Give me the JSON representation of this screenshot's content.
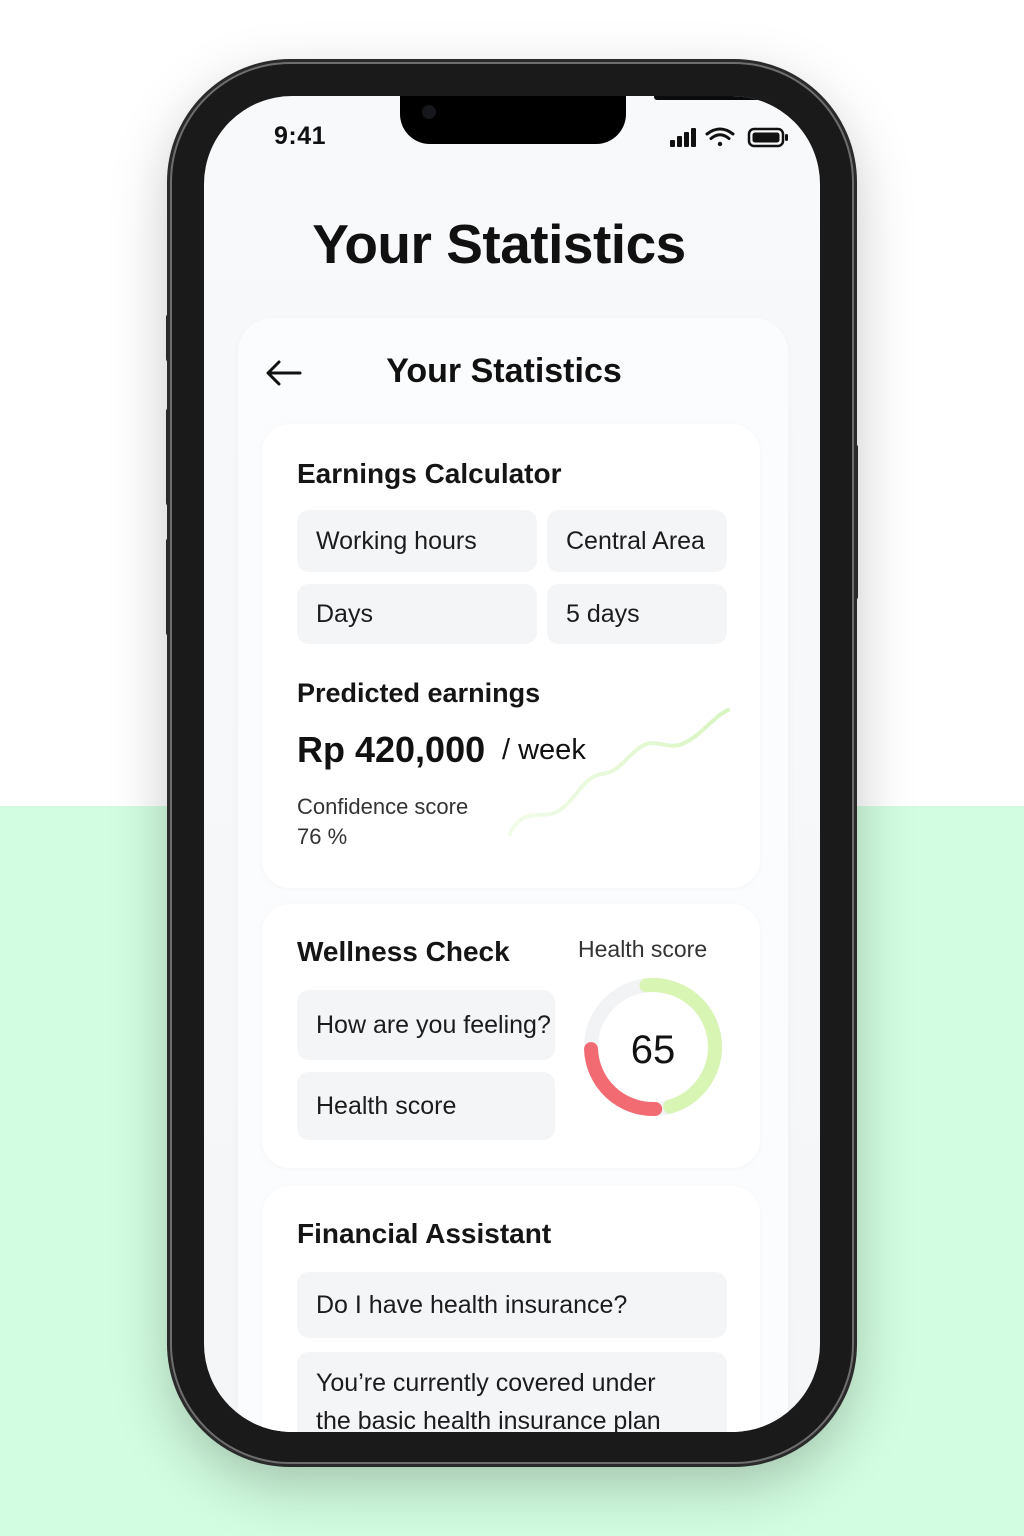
{
  "status_bar": {
    "time": "9:41"
  },
  "page_title": "Your Statistics",
  "header": {
    "title": "Your Statistics"
  },
  "earnings": {
    "title": "Earnings Calculator",
    "fields": [
      {
        "label": "Working hours"
      },
      {
        "label": "Central Area"
      },
      {
        "label": "Days"
      },
      {
        "label": "5 days"
      }
    ],
    "predicted_label": "Predicted earnings",
    "amount": "Rp 420,000",
    "per": "/ week",
    "confidence_label": "Confidence score",
    "confidence_value": "76 %"
  },
  "wellness": {
    "title": "Wellness Check",
    "feeling_label": "How are you feeling?",
    "health_button": "Health score",
    "gauge_label": "Health score",
    "gauge_value": "65",
    "gauge_fraction": 0.65
  },
  "assistant": {
    "title": "Financial Assistant",
    "question": "Do I have health insurance?",
    "answer_line1": "You’re currently covered under",
    "answer_line2": "the basic health insurance plan"
  },
  "colors": {
    "background_green": "#d2fde0",
    "gauge_green": "#d8f5b4",
    "gauge_red": "#f26b72",
    "sparkline": "#dff7c9"
  }
}
